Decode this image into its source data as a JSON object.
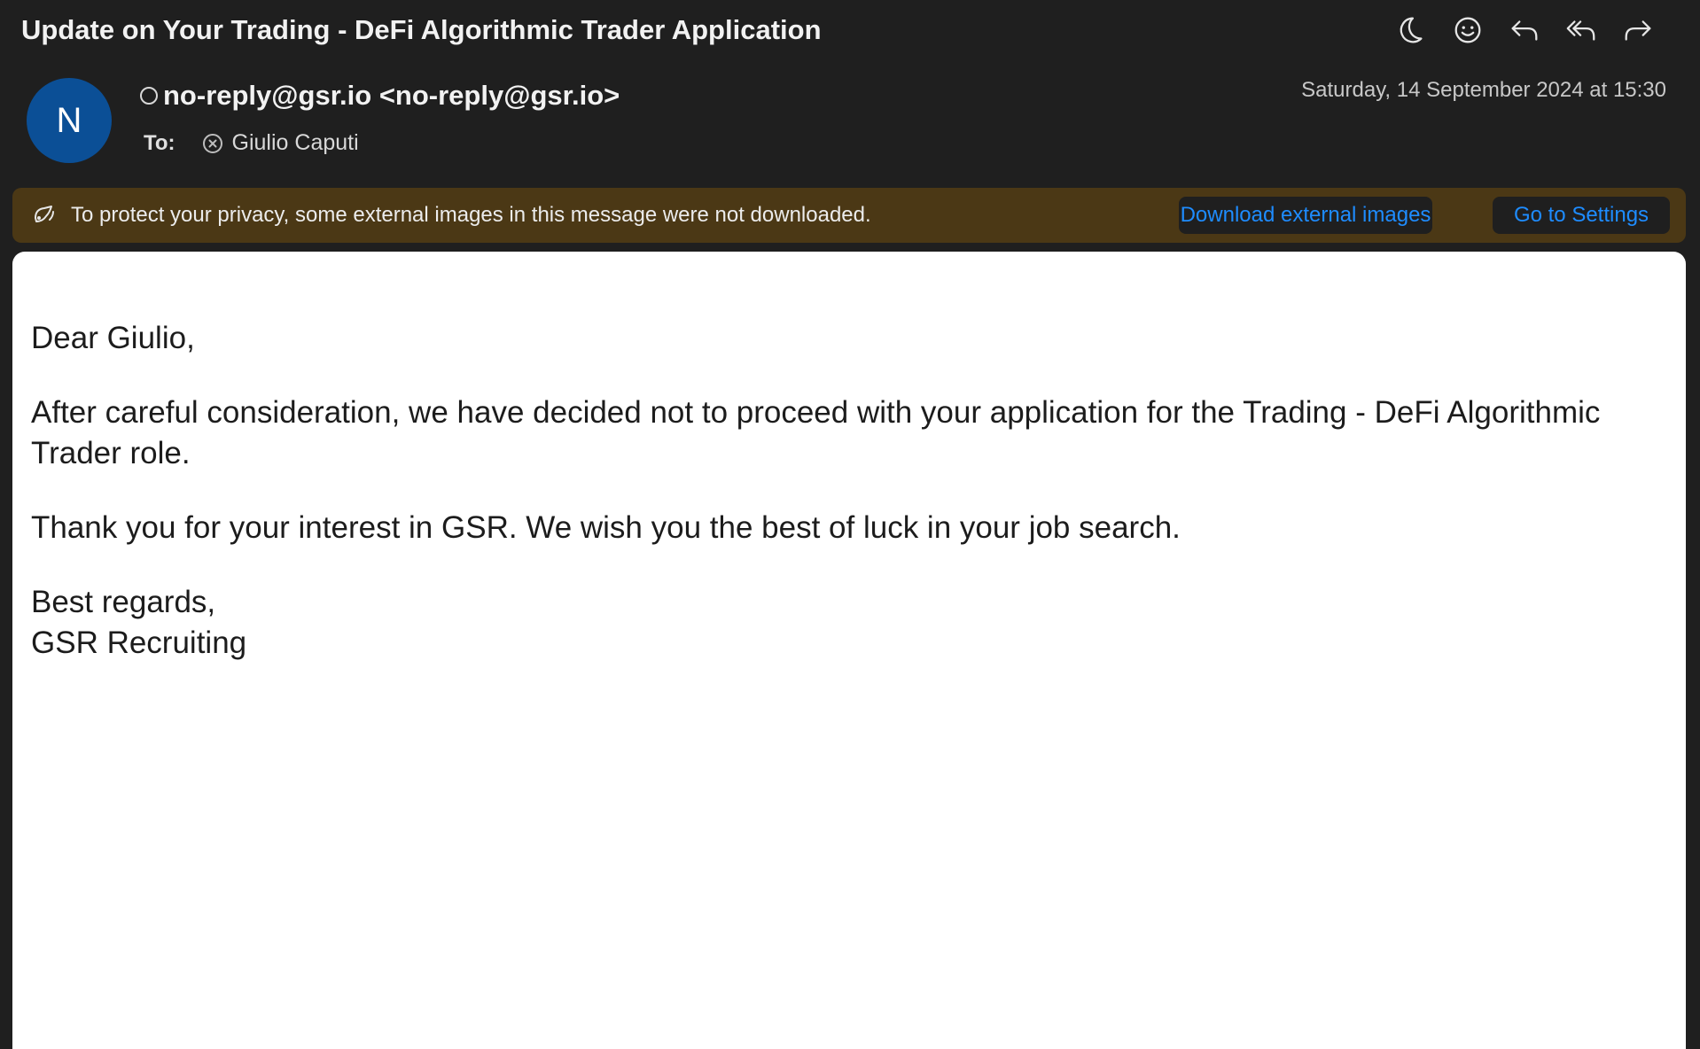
{
  "header": {
    "subject": "Update on Your Trading - DeFi Algorithmic Trader Application",
    "toolbar": [
      {
        "icon": "moon-icon"
      },
      {
        "icon": "smiley-icon"
      },
      {
        "icon": "reply-icon"
      },
      {
        "icon": "reply-all-icon"
      },
      {
        "icon": "forward-icon"
      }
    ]
  },
  "sender": {
    "avatar_initial": "N",
    "avatar_color": "#0b4f96",
    "name": "no-reply@gsr.io <no-reply@gsr.io>",
    "date": "Saturday, 14 September 2024 at 15:30"
  },
  "recipients": {
    "to_label": "To:",
    "name": "Giulio Caputi"
  },
  "privacy_banner": {
    "text": "To protect your privacy, some external images in this message were not downloaded.",
    "download_label": "Download external images",
    "settings_label": "Go to Settings",
    "background": "#4b3815",
    "link_color": "#1e8cff"
  },
  "message": {
    "greeting": "Dear Giulio,",
    "paragraph1": "After careful consideration, we have decided not to proceed with your application for the Trading - DeFi Algorithmic Trader role.",
    "paragraph2": "Thank you for your interest in GSR. We wish you the best of luck in your job search.",
    "closing": "Best regards,",
    "signature": "GSR Recruiting"
  }
}
